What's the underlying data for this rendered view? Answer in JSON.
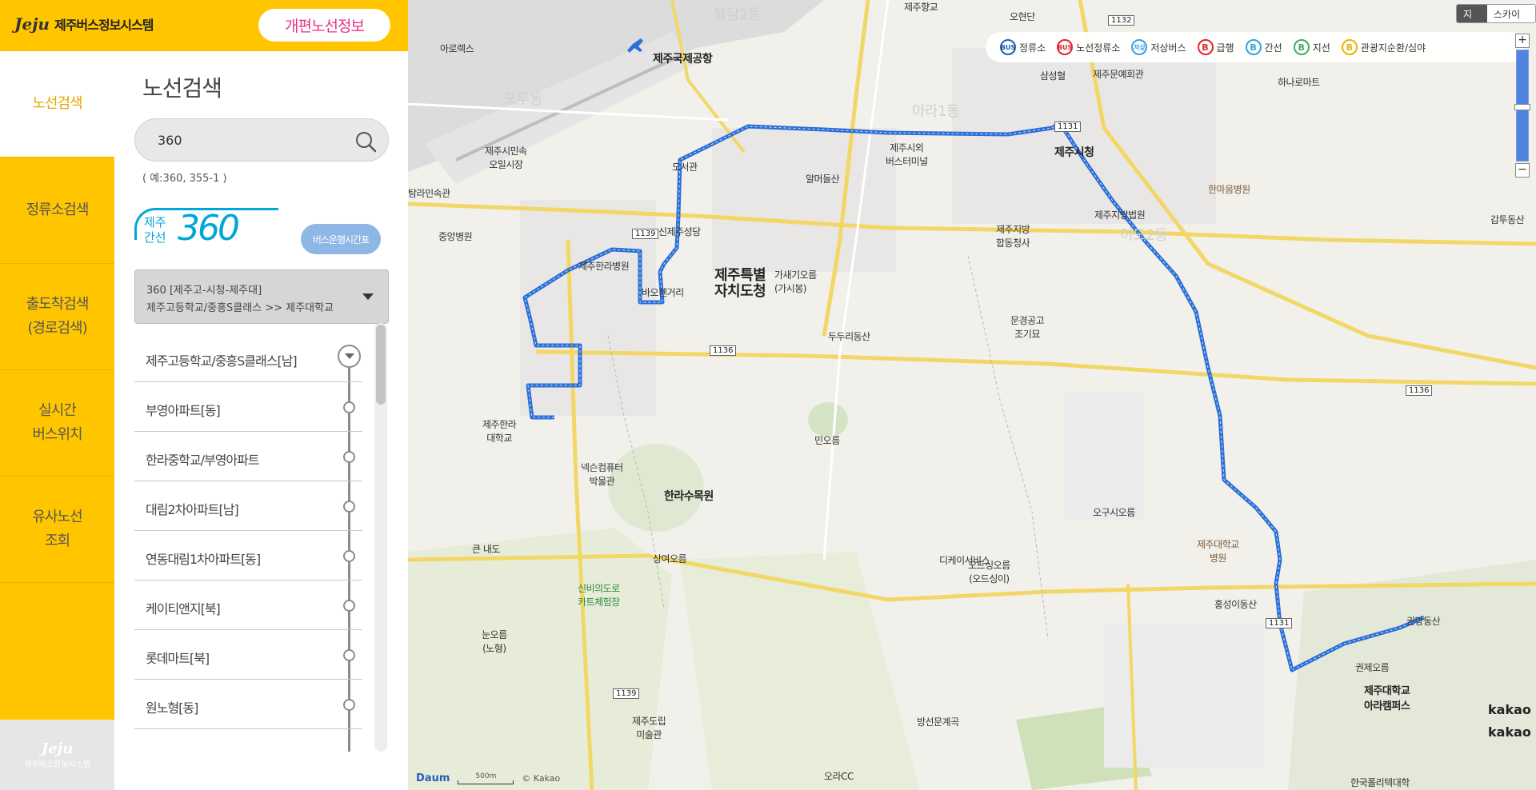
{
  "header": {
    "logo_mark": "Jeju",
    "logo_title": "제주버스정보시스템",
    "notice_button": "개편노선정보"
  },
  "nav": {
    "items": [
      {
        "label": "노선검색",
        "active": true
      },
      {
        "label": "정류소검색",
        "active": false
      },
      {
        "label": "출도착검색\n(경로검색)",
        "active": false
      },
      {
        "label": "실시간\n버스위치",
        "active": false
      },
      {
        "label": "유사노선\n조회",
        "active": false
      }
    ],
    "footer_mark": "Jeju",
    "footer_title": "제주버스정보시스템"
  },
  "panel": {
    "title": "노선검색",
    "search_value": "360",
    "search_hint": "( 예:360, 355-1 )",
    "route_type": "제주\n간선",
    "route_number": "360",
    "timetable_button": "버스운행시간표",
    "route_select_line1": "360 [제주고-시청-제주대]",
    "route_select_line2": "제주고등학교/중흥S클래스 >> 제주대학교",
    "stops": [
      "제주고등학교/중흥S클래스[남]",
      "부영아파트[동]",
      "한라중학교/부영아파트",
      "대림2차아파트[남]",
      "연동대림1차아파트[동]",
      "케이티앤지[북]",
      "롯데마트[북]",
      "원노형[동]"
    ]
  },
  "map": {
    "type_buttons": [
      "지도",
      "스카이뷰"
    ],
    "legend": [
      {
        "icon": "BUS",
        "label": "정류소",
        "color": "#1e5fb4"
      },
      {
        "icon": "BUS",
        "label": "노선정류소",
        "color": "#e0242e"
      },
      {
        "icon": "저상",
        "label": "저상버스",
        "color": "#3aa0e0"
      },
      {
        "icon": "B",
        "label": "급행",
        "color": "#e0242e"
      },
      {
        "icon": "B",
        "label": "간선",
        "color": "#2ba6d8"
      },
      {
        "icon": "B",
        "label": "지선",
        "color": "#3cae5a"
      },
      {
        "icon": "B",
        "label": "관광지순환/심야",
        "color": "#e8b400"
      }
    ],
    "zoom_in": "+",
    "zoom_out": "−",
    "scale": "500m",
    "attribution": "© Kakao",
    "provider": "Daum",
    "kakao": "kakao",
    "route_color": "#2b6fd6",
    "labels": [
      "제주향교",
      "오현단",
      "용담2동",
      "제주국제공항",
      "도두동",
      "제주문예회관",
      "하나로마트",
      "삼성혈",
      "제주시청",
      "제주시외\n버스터미널",
      "제주시민속\n오일시장",
      "도서관",
      "아라1동",
      "알머들산",
      "한마음병원",
      "제주지방법원",
      "제주지방\n합동청사",
      "이도2동",
      "탐라민속관",
      "중앙병원",
      "신제주성당",
      "제주한라병원",
      "바오젠거리",
      "제주특별\n자치도청",
      "가새기오름\n(가시봉)",
      "문경공고\n조기묘",
      "두두리동산",
      "제주한라\n대학교",
      "넥슨컴퓨터\n박물관",
      "한라수목원",
      "민오름",
      "오드싱오름\n(오드싱이)",
      "오구시오름",
      "제주대학교\n병원",
      "큰 내도",
      "상여오름",
      "디케이서비스",
      "신비의도로\n카트체험장",
      "홍성이동산",
      "권망동산",
      "눈오름\n(노형)",
      "권제오름",
      "제주대학교\n아라캠퍼스",
      "제주도립\n미술관",
      "방선문계곡",
      "오라CC",
      "한국폴리텍대학",
      "감투동산",
      "아로렉스"
    ],
    "roads": [
      "1132",
      "1139",
      "1136",
      "1131",
      "1136",
      "1131",
      "1139",
      "1139"
    ]
  }
}
